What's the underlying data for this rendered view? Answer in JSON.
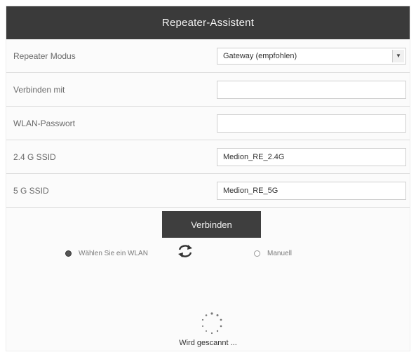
{
  "header": {
    "title": "Repeater-Assistent"
  },
  "rows": [
    {
      "label": "Repeater Modus",
      "value": "Gateway (empfohlen)"
    },
    {
      "label": "Verbinden mit",
      "value": ""
    },
    {
      "label": "WLAN-Passwort",
      "value": ""
    },
    {
      "label": "2.4 G SSID",
      "value": "Medion_RE_2.4G"
    },
    {
      "label": "5 G SSID",
      "value": "Medion_RE_5G"
    }
  ],
  "connect_button": {
    "label": "Verbinden"
  },
  "options": {
    "wlan_label": "Wählen Sie ein WLAN",
    "manual_label": "Manuell"
  },
  "status": {
    "text": "Wird gescannt ..."
  },
  "colors": {
    "header_bg": "#3a3a3a",
    "button_bg": "#3e3e3e"
  }
}
